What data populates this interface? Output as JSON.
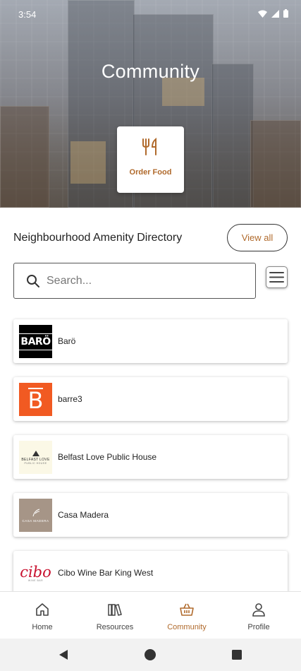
{
  "status_bar": {
    "time": "3:54"
  },
  "hero": {
    "title": "Community"
  },
  "quick_action": {
    "label": "Order Food",
    "icon": "fork-knife-icon"
  },
  "directory": {
    "title": "Neighbourhood Amenity Directory",
    "view_all_label": "View all"
  },
  "search": {
    "placeholder": "Search..."
  },
  "amenities": [
    {
      "name": "Barö",
      "logo_text": "BARÖ",
      "logo_bg": "#000000",
      "logo_fg": "#ffffff"
    },
    {
      "name": "barre3",
      "logo_text": "B",
      "logo_bg": "#f15a22",
      "logo_fg": "#ffffff"
    },
    {
      "name": "Belfast Love Public House",
      "logo_text": "BELFAST LOVE",
      "logo_sub": "PUBLIC HOUSE",
      "logo_bg": "#fbf8e6",
      "logo_fg": "#333333"
    },
    {
      "name": "Casa Madera",
      "logo_text": "CASA MADERA",
      "logo_bg": "#a69587",
      "logo_fg": "#ffffff"
    },
    {
      "name": "Cibo Wine Bar King West",
      "logo_text": "cibo",
      "logo_sub": "WINE BAR",
      "logo_bg": "#ffffff",
      "logo_fg": "#c8102e"
    }
  ],
  "bottom_nav": [
    {
      "label": "Home",
      "icon": "home-icon",
      "active": false
    },
    {
      "label": "Resources",
      "icon": "books-icon",
      "active": false
    },
    {
      "label": "Community",
      "icon": "basket-icon",
      "active": true
    },
    {
      "label": "Profile",
      "icon": "person-icon",
      "active": false
    }
  ],
  "colors": {
    "accent": "#b06a2c"
  }
}
